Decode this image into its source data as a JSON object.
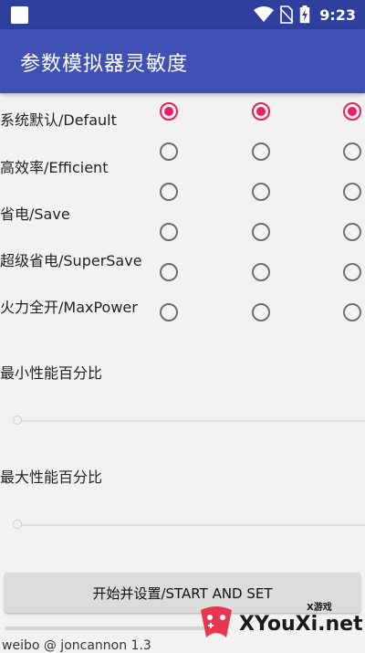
{
  "status_bar": {
    "time": "9:23",
    "icons": [
      "square-icon",
      "wifi-icon",
      "no-sim-icon",
      "battery-charging-icon"
    ]
  },
  "app_bar": {
    "title": "参数模拟器灵敏度"
  },
  "rows": [
    {
      "label": "系统默认/Default",
      "checked": [
        true,
        true,
        true
      ]
    },
    {
      "label": "高效率/Efficient",
      "checked": [
        false,
        false,
        false
      ]
    },
    {
      "label": "省电/Save",
      "checked": [
        false,
        false,
        false
      ]
    },
    {
      "label": "超级省电/SuperSave",
      "checked": [
        false,
        false,
        false
      ]
    },
    {
      "label": "火力全开/MaxPower",
      "checked": [
        false,
        false,
        false
      ]
    },
    {
      "label": "",
      "checked": [
        false,
        false,
        false
      ]
    }
  ],
  "min_perf": {
    "label": "最小性能百分比",
    "value": 0
  },
  "max_perf": {
    "label": "最大性能百分比",
    "value": 0
  },
  "start_button": {
    "label": "开始并设置/START AND SET"
  },
  "footer": {
    "text": "weibo @ joncannon 1.3"
  },
  "watermark": {
    "text": "XYouXi.net",
    "sub": "X游戏"
  },
  "colors": {
    "primary": "#3f51b5",
    "status_bar": "#2f3f9e",
    "accent": "#e91e63"
  }
}
